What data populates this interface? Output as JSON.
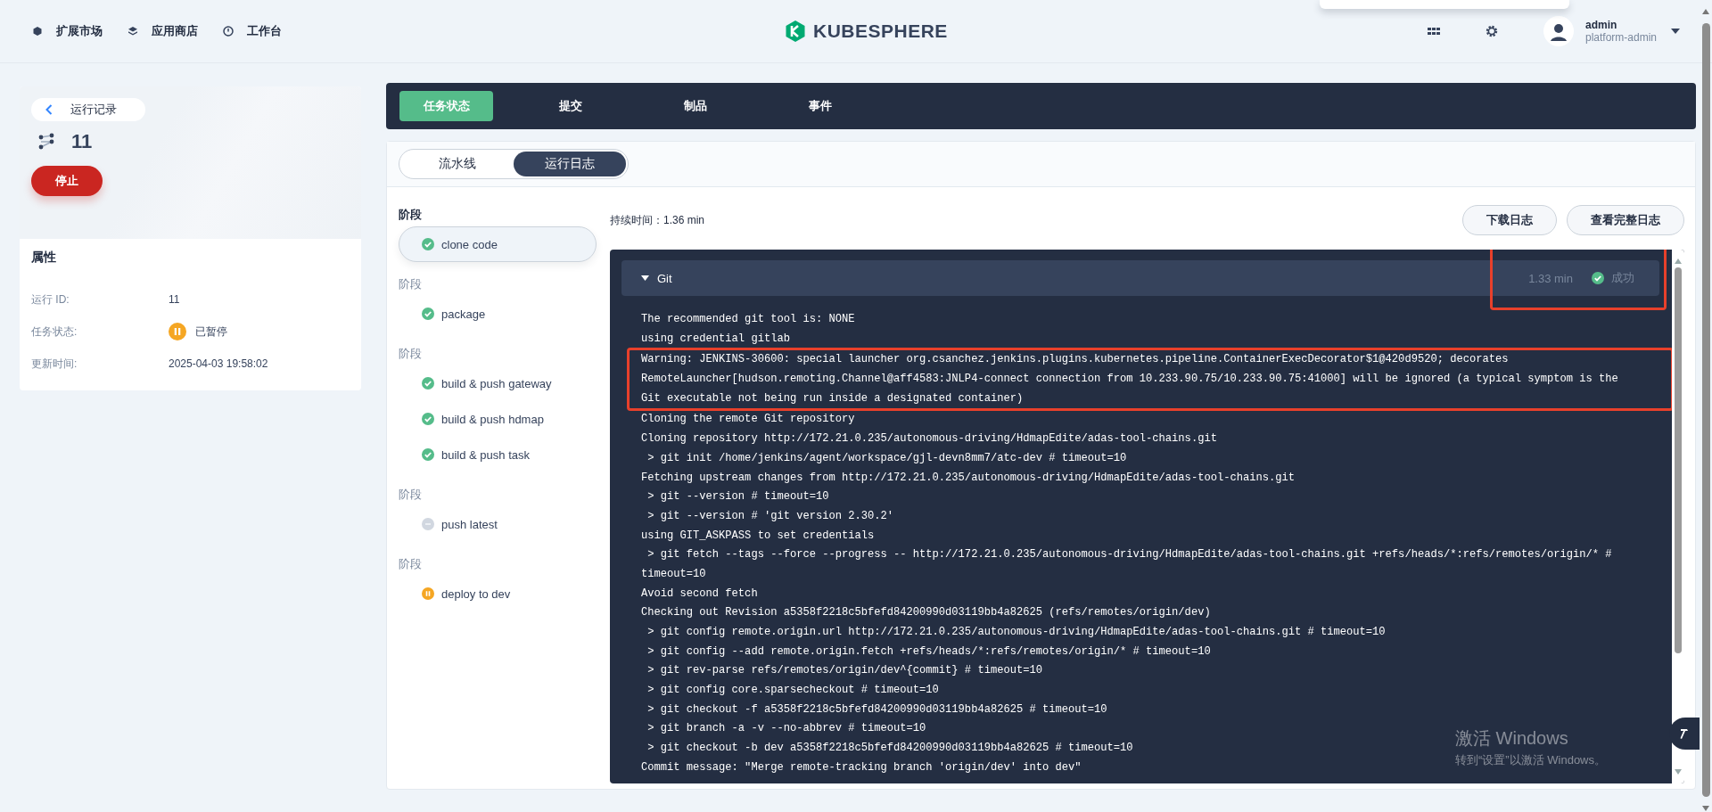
{
  "topbar": {
    "nav": [
      {
        "label": "扩展市场"
      },
      {
        "label": "应用商店"
      },
      {
        "label": "工作台"
      }
    ],
    "logo_text": "KUBESPHERE",
    "user": {
      "name": "admin",
      "role": "platform-admin"
    }
  },
  "run": {
    "back_label": "运行记录",
    "id": "11",
    "stop_button": "停止",
    "properties_title": "属性",
    "properties": [
      {
        "label": "运行 ID:",
        "value": "11"
      },
      {
        "label": "任务状态:",
        "value": "已暂停",
        "kind": "paused"
      },
      {
        "label": "更新时间:",
        "value": "2025-04-03 19:58:02"
      }
    ]
  },
  "tabs": [
    {
      "label": "任务状态",
      "selected": true
    },
    {
      "label": "提交",
      "selected": false
    },
    {
      "label": "制品",
      "selected": false
    },
    {
      "label": "事件",
      "selected": false
    }
  ],
  "view_toggle": [
    {
      "label": "流水线",
      "selected": false
    },
    {
      "label": "运行日志",
      "selected": true
    }
  ],
  "stages": [
    {
      "title": "阶段",
      "steps": [
        {
          "name": "clone code",
          "kind": "success",
          "selected": true
        }
      ]
    },
    {
      "title": "阶段",
      "steps": [
        {
          "name": "package",
          "kind": "success",
          "selected": false
        }
      ]
    },
    {
      "title": "阶段",
      "steps": [
        {
          "name": "build & push gateway",
          "kind": "success",
          "selected": false
        },
        {
          "name": "build & push hdmap",
          "kind": "success",
          "selected": false
        },
        {
          "name": "build & push task",
          "kind": "success",
          "selected": false
        }
      ]
    },
    {
      "title": "阶段",
      "steps": [
        {
          "name": "push latest",
          "kind": "skipped",
          "selected": false
        }
      ]
    },
    {
      "title": "阶段",
      "steps": [
        {
          "name": "deploy to dev",
          "kind": "paused",
          "selected": false
        }
      ]
    }
  ],
  "log": {
    "duration": "持续时间：1.36 min",
    "buttons": [
      "下载日志",
      "查看完整日志"
    ],
    "sections": [
      {
        "title": "Git",
        "expanded": true,
        "time": "1.33 min",
        "kind": "success",
        "status_label": "成功",
        "highlighted": true,
        "lines": [
          {
            "text": "The recommended git tool is: NONE",
            "highlighted": false
          },
          {
            "text": "using credential gitlab",
            "highlighted": false
          },
          {
            "text": "Warning: JENKINS-30600: special launcher org.csanchez.jenkins.plugins.kubernetes.pipeline.ContainerExecDecorator$1@420d9520; decorates",
            "highlighted": true
          },
          {
            "text": "RemoteLauncher[hudson.remoting.Channel@aff4583:JNLP4-connect connection from 10.233.90.75/10.233.90.75:41000] will be ignored (a typical symptom is the",
            "highlighted": true
          },
          {
            "text": "Git executable not being run inside a designated container)",
            "highlighted": true
          },
          {
            "text": "Cloning the remote Git repository",
            "highlighted": false
          },
          {
            "text": "Cloning repository http://172.21.0.235/autonomous-driving/HdmapEdite/adas-tool-chains.git",
            "highlighted": false
          },
          {
            "text": " > git init /home/jenkins/agent/workspace/gjl-devn8mm7/atc-dev # timeout=10",
            "highlighted": false
          },
          {
            "text": "Fetching upstream changes from http://172.21.0.235/autonomous-driving/HdmapEdite/adas-tool-chains.git",
            "highlighted": false
          },
          {
            "text": " > git --version # timeout=10",
            "highlighted": false
          },
          {
            "text": " > git --version # 'git version 2.30.2'",
            "highlighted": false
          },
          {
            "text": "using GIT_ASKPASS to set credentials",
            "highlighted": false
          },
          {
            "text": " > git fetch --tags --force --progress -- http://172.21.0.235/autonomous-driving/HdmapEdite/adas-tool-chains.git +refs/heads/*:refs/remotes/origin/* #",
            "highlighted": false
          },
          {
            "text": "timeout=10",
            "highlighted": false
          },
          {
            "text": "Avoid second fetch",
            "highlighted": false
          },
          {
            "text": "Checking out Revision a5358f2218c5bfefd84200990d03119bb4a82625 (refs/remotes/origin/dev)",
            "highlighted": false
          },
          {
            "text": " > git config remote.origin.url http://172.21.0.235/autonomous-driving/HdmapEdite/adas-tool-chains.git # timeout=10",
            "highlighted": false
          },
          {
            "text": " > git config --add remote.origin.fetch +refs/heads/*:refs/remotes/origin/* # timeout=10",
            "highlighted": false
          },
          {
            "text": " > git rev-parse refs/remotes/origin/dev^{commit} # timeout=10",
            "highlighted": false
          },
          {
            "text": " > git config core.sparsecheckout # timeout=10",
            "highlighted": false
          },
          {
            "text": " > git checkout -f a5358f2218c5bfefd84200990d03119bb4a82625 # timeout=10",
            "highlighted": false
          },
          {
            "text": " > git branch -a -v --no-abbrev # timeout=10",
            "highlighted": false
          },
          {
            "text": " > git checkout -b dev a5358f2218c5bfefd84200990d03119bb4a82625 # timeout=10",
            "highlighted": false
          },
          {
            "text": "Commit message: \"Merge remote-tracking branch 'origin/dev' into dev\"",
            "highlighted": false
          }
        ]
      }
    ]
  },
  "os_notice": {
    "title": "激活 Windows",
    "text": "转到“设置”以激活 Windows。"
  }
}
